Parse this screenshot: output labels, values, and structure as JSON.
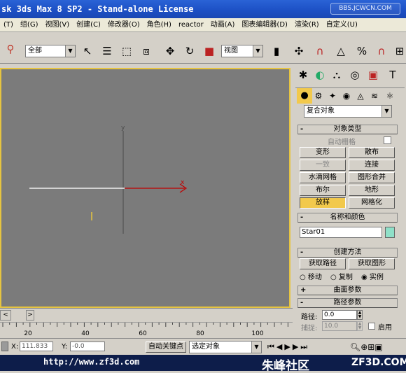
{
  "title": "sk 3ds Max 8 SP2  - Stand-alone License",
  "watermark_top": "BBS.JCWCN.COM",
  "menu": [
    "(T)",
    "组(G)",
    "视图(V)",
    "创建(C)",
    "修改器(O)",
    "角色(H)",
    "reactor",
    "动画(A)",
    "图表编辑器(D)",
    "渲染(R)",
    "自定义(U)"
  ],
  "toolbar": {
    "selection_filter": "全部",
    "ref_coord": "视图"
  },
  "viewport": {
    "axis_y": "y",
    "axis_x": "x"
  },
  "panel": {
    "category_dropdown": "复合对象",
    "object_type": {
      "title": "对象类型",
      "autogrid": "自动栅格",
      "buttons": [
        [
          "变形",
          "散布"
        ],
        [
          "一致",
          "连接"
        ],
        [
          "水滴网格",
          "图形合并"
        ],
        [
          "布尔",
          "地形"
        ],
        [
          "放样",
          "网格化"
        ]
      ]
    },
    "name_color": {
      "title": "名称和颜色",
      "name": "Star01"
    },
    "creation_method": {
      "title": "创建方法",
      "get_path": "获取路径",
      "get_shape": "获取图形",
      "move": "移动",
      "copy": "复制",
      "instance": "实例"
    },
    "surface_params": "曲面参数",
    "path_params": {
      "title": "路径参数",
      "path_label": "路径:",
      "path_value": "0.0",
      "snap_label": "捕捉:",
      "snap_value": "10.0",
      "enable": "启用"
    }
  },
  "ruler": {
    "ticks": [
      "20",
      "40",
      "60",
      "80",
      "100"
    ]
  },
  "status": {
    "x_label": "X:",
    "x_value": "111.833",
    "y_label": "Y:",
    "y_value": "-0.0",
    "autokey": "自动关键点",
    "selected": "选定对象"
  },
  "bottom": {
    "url": "http://www.zf3d.com",
    "site": "朱峰社区",
    "brand": "ZF3D.COM"
  },
  "colors": {
    "viewport_bg": "#7b7b7b",
    "viewport_border": "#e6c440",
    "active_button": "#f2c94c",
    "swatch": "#8fe0c8"
  }
}
